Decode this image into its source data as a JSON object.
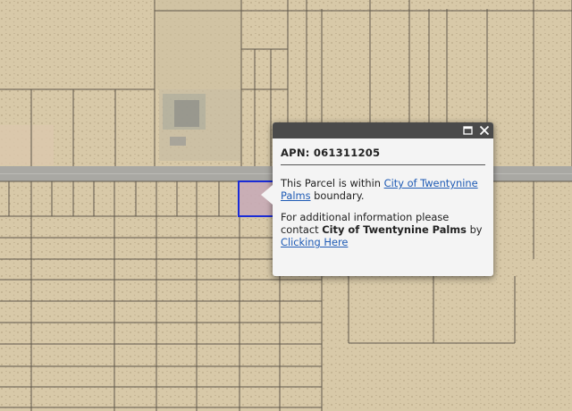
{
  "popup": {
    "apn_label": "APN:",
    "apn_value": "061311205",
    "line1_prefix": "This Parcel is within",
    "jurisdiction_link": "City of Twentynine Palms",
    "line1_suffix": "boundary.",
    "line2_prefix": "For additional information please contact",
    "contact_name": "City of Twentynine Palms",
    "line2_by": "by",
    "contact_link": "Clicking Here",
    "maximize_icon": "maximize-icon",
    "close_icon": "close-icon"
  },
  "map": {
    "basemap": "satellite",
    "selected_parcel_color": "#1a2bd6",
    "road_color": "#a7a6a2",
    "parcel_line_color": "#5e564a"
  }
}
